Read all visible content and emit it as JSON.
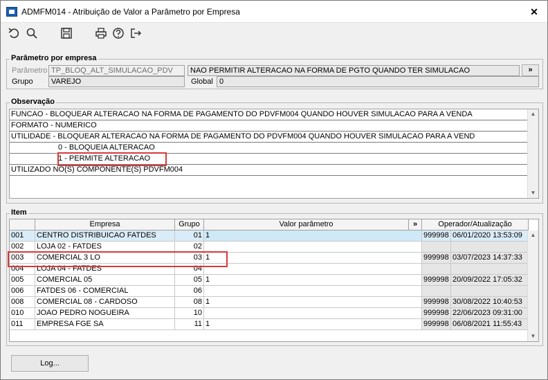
{
  "window": {
    "title": "ADMFM014 - Atribuição de Valor a Parâmetro por Empresa",
    "close": "✕"
  },
  "toolbar": {
    "icons": [
      "undo-icon",
      "search-icon",
      "save-icon",
      "print-icon",
      "help-icon",
      "exit-icon"
    ]
  },
  "param_group": {
    "title": "Parâmetro por empresa",
    "param_label": "Parâmetro",
    "param_code": "TP_BLOQ_ALT_SIMULACAO_PDV",
    "param_desc": "NAO PERMITIR ALTERACAO NA FORMA DE PGTO QUANDO TER SIMULACAO",
    "expand": "»",
    "group_label": "Grupo",
    "group_value": "VAREJO",
    "global_label": "Global",
    "global_value": "0"
  },
  "observacao": {
    "title": "Observação",
    "lines": [
      "FUNCAO - BLOQUEAR ALTERACAO NA FORMA DE PAGAMENTO DO PDVFM004 QUANDO HOUVER SIMULACAO PARA A VENDA",
      "FORMATO - NUMERICO",
      "UTILIDADE - BLOQUEAR ALTERACAO NA FORMA DE PAGAMENTO DO PDVFM004 QUANDO HOUVER SIMULACAO PARA A VEND",
      "0 - BLOQUEIA ALTERACAO",
      "1 - PERMITE ALTERACAO",
      "UTILIZADO NO(S) COMPONENTE(S) PDVFM004"
    ]
  },
  "item": {
    "title": "Item",
    "columns": {
      "empresa": "Empresa",
      "grupo": "Grupo",
      "valor": "Valor parâmetro",
      "expand": "»",
      "operador": "Operador/Atualização"
    },
    "rows": [
      {
        "code": "001",
        "name": "CENTRO DISTRIBUICAO FATDES",
        "grupo": "01",
        "valor": "1",
        "op": "999998",
        "date": "06/01/2020 13:53:09"
      },
      {
        "code": "002",
        "name": "LOJA 02 - FATDES",
        "grupo": "02",
        "valor": "",
        "op": "",
        "date": ""
      },
      {
        "code": "003",
        "name": "COMERCIAL 3 LO",
        "grupo": "03",
        "valor": "1",
        "op": "999998",
        "date": "03/07/2023 14:37:33"
      },
      {
        "code": "004",
        "name": "LOJA 04 - FATDES",
        "grupo": "04",
        "valor": "",
        "op": "",
        "date": ""
      },
      {
        "code": "005",
        "name": "COMERCIAL 05",
        "grupo": "05",
        "valor": "1",
        "op": "999998",
        "date": "20/09/2022 17:05:32"
      },
      {
        "code": "006",
        "name": "FATDES 06 - COMERCIAL",
        "grupo": "06",
        "valor": "",
        "op": "",
        "date": ""
      },
      {
        "code": "008",
        "name": "COMERCIAL 08 - CARDOSO",
        "grupo": "08",
        "valor": "1",
        "op": "999998",
        "date": "30/08/2022 10:40:53"
      },
      {
        "code": "010",
        "name": "JOAO PEDRO NOGUEIRA",
        "grupo": "10",
        "valor": "",
        "op": "999998",
        "date": "22/06/2023 09:31:00"
      },
      {
        "code": "011",
        "name": "EMPRESA FGE SA",
        "grupo": "11",
        "valor": "1",
        "op": "999998",
        "date": "06/08/2021 11:55:43"
      }
    ]
  },
  "footer": {
    "log_button": "Log..."
  }
}
